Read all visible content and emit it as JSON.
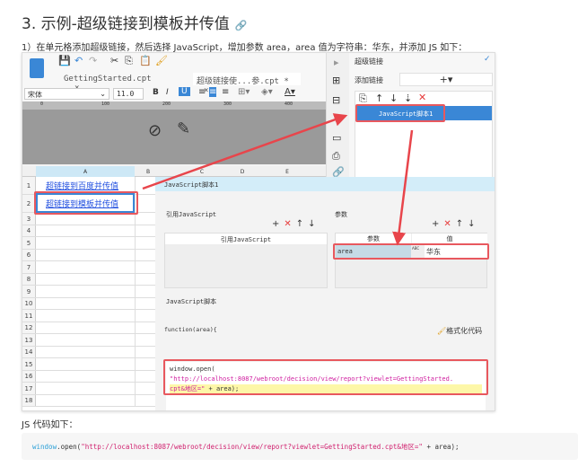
{
  "heading": "3. 示例-超级链接到模板并传值",
  "intro": "1）在单元格添加超级链接，然后选择 JavaScript，增加参数 area，area 值为字符串：华东，并添加 JS 如下：",
  "designer": {
    "tabs": [
      "GettingStarted.cpt",
      "超级链接使...参.cpt *"
    ],
    "font": "宋体",
    "font_size": "11.0",
    "ruler": [
      "0",
      "100",
      "200",
      "300",
      "400"
    ],
    "columns": [
      "A",
      "B",
      "C",
      "D",
      "E"
    ],
    "rows": [
      "1",
      "2",
      "3",
      "4",
      "5",
      "6",
      "7",
      "8",
      "9",
      "10",
      "11",
      "12",
      "13",
      "14",
      "15",
      "16",
      "17",
      "18"
    ],
    "cells": {
      "a1": "超链接到百度并传值",
      "a2": "超链接到模板并传值"
    }
  },
  "hyperlink_panel": {
    "title": "超级链接",
    "add_label": "添加链接",
    "item": "JavaScript脚本1"
  },
  "dialog": {
    "title": "JavaScript脚本1",
    "ref_js_label": "引用JavaScript",
    "ref_js_header": "引用JavaScript",
    "params_label": "参数",
    "param_col": "参数",
    "value_col": "值",
    "param_name": "area",
    "param_value": "华东",
    "type_icon": "ABC",
    "script_label": "JavaScript脚本",
    "function_sig": "function(area){",
    "format_btn": "格式化代码",
    "code_1": "window.open(",
    "code_2": "\"http://localhost:8087/webroot/decision/view/report?viewlet=GettingStarted.",
    "code_3a": "cpt&地区=\"",
    "code_3b": " + area);"
  },
  "js_caption": "JS 代码如下：",
  "code_block": {
    "obj": "window",
    "method": ".open(",
    "str": "\"http://localhost:8087/webroot/decision/view/report?viewlet=GettingStarted.cpt&地区=\"",
    "rest": " + area);"
  }
}
